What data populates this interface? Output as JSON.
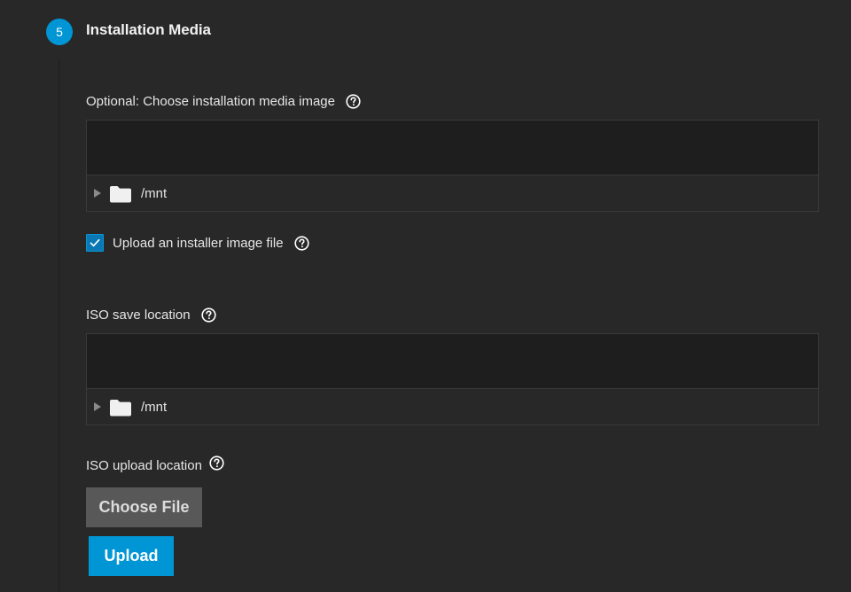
{
  "step": {
    "number": "5",
    "title": "Installation Media"
  },
  "installation_media": {
    "label": "Optional: Choose installation media image",
    "help_icon": "help-circle-icon",
    "tree": {
      "root": "/mnt",
      "expand_icon": "triangle-right-icon",
      "folder_icon": "folder-icon"
    }
  },
  "upload_checkbox": {
    "label": "Upload an installer image file",
    "checked": true,
    "help_icon": "help-circle-icon"
  },
  "iso_save_location": {
    "label": "ISO save location",
    "help_icon": "help-circle-icon",
    "tree": {
      "root": "/mnt",
      "expand_icon": "triangle-right-icon",
      "folder_icon": "folder-icon"
    }
  },
  "iso_upload_location": {
    "label": "ISO upload location",
    "help_icon": "help-circle-icon",
    "choose_file_label": "Choose File",
    "upload_label": "Upload"
  },
  "colors": {
    "background": "#282828",
    "accent": "#0095d5",
    "tree_header": "#1e1e1e",
    "choose_file_button": "#585858"
  }
}
